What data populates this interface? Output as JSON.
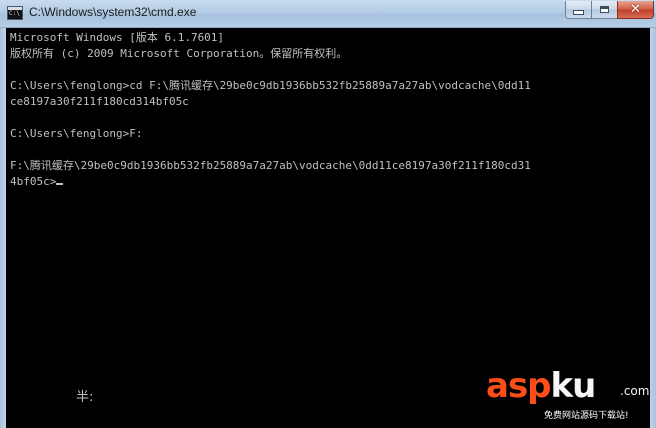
{
  "window": {
    "title": "C:\\Windows\\system32\\cmd.exe",
    "icon_label": "C:\\",
    "icon_name": "cmd-app-icon"
  },
  "controls": {
    "minimize_icon": "minimize-icon",
    "maximize_icon": "maximize-icon",
    "close_glyph": "✕"
  },
  "console": {
    "foreground": "#c0c0c0",
    "background": "#000000",
    "lines": [
      "Microsoft Windows [版本 6.1.7601]",
      "版权所有 (c) 2009 Microsoft Corporation。保留所有权利。",
      "",
      "C:\\Users\\fenglong>cd F:\\腾讯缓存\\29be0c9db1936bb532fb25889a7a27ab\\vodcache\\0dd11",
      "ce8197a30f211f180cd314bf05c",
      "",
      "C:\\Users\\fenglong>F:",
      "",
      "F:\\腾讯缓存\\29be0c9db1936bb532fb25889a7a27ab\\vodcache\\0dd11ce8197a30f211f180cd31",
      "4bf05c>"
    ],
    "ime_status": "半:"
  },
  "watermark": {
    "brand_part1": "asp",
    "brand_part2": "ku",
    "domain_suffix": ".com",
    "tagline": "免费网站源码下载站!",
    "accent_color": "#ff4d1a"
  }
}
